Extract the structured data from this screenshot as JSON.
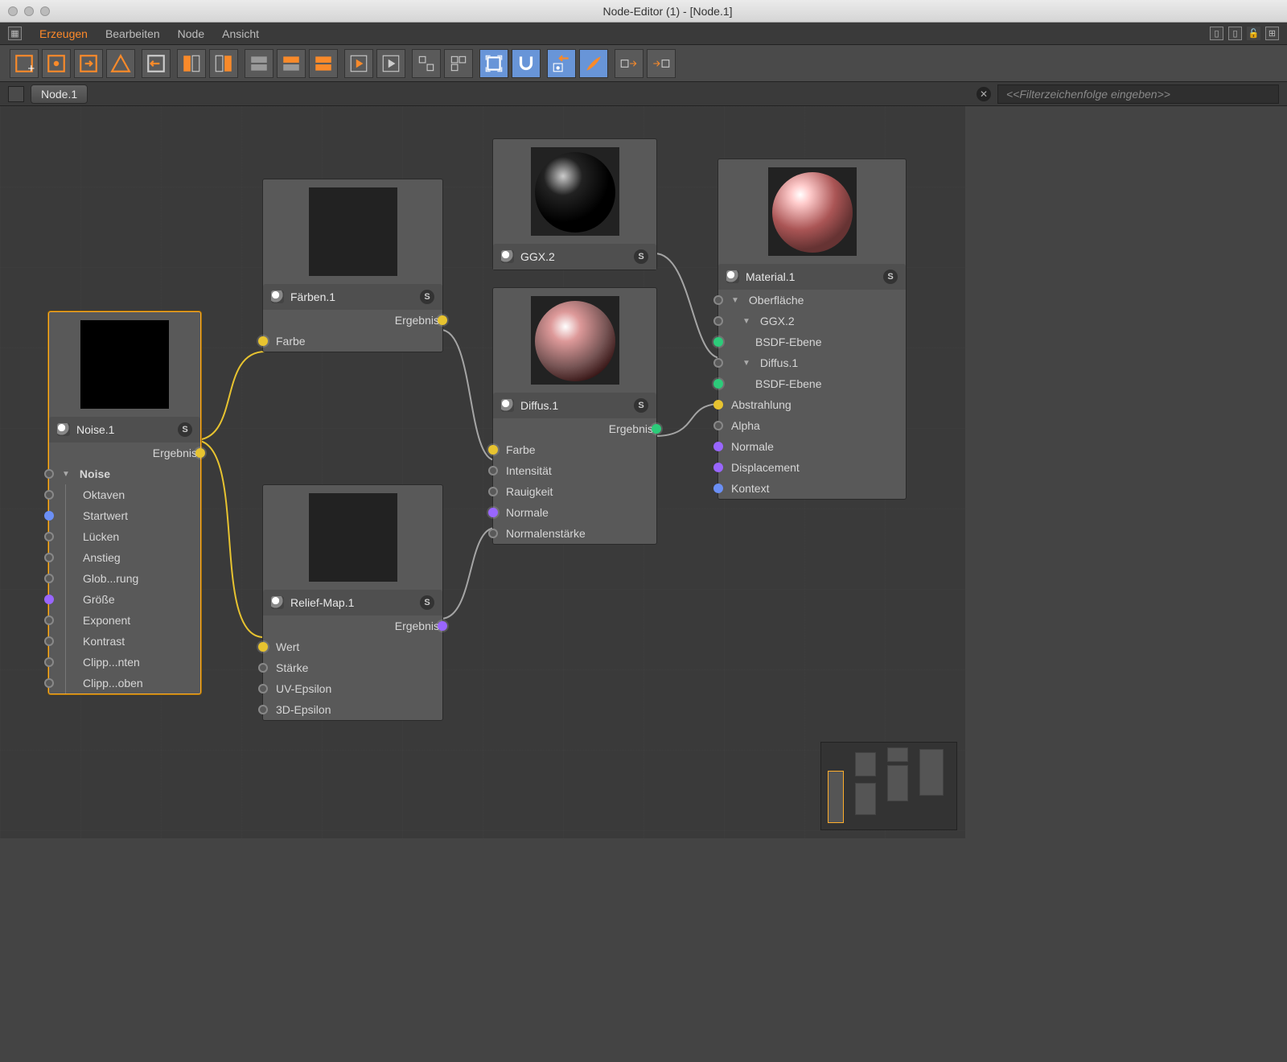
{
  "window": {
    "title": "Node-Editor (1) - [Node.1]"
  },
  "menu": {
    "erzeugen": "Erzeugen",
    "bearbeiten": "Bearbeiten",
    "node": "Node",
    "ansicht": "Ansicht"
  },
  "breadcrumb": "Node.1",
  "filter_placeholder": "<<Filterzeichenfolge eingeben>>",
  "nodes": {
    "noise": {
      "title": "Noise.1",
      "out": "Ergebnis",
      "group": "Noise",
      "params": [
        "Oktaven",
        "Startwert",
        "Lücken",
        "Anstieg",
        "Glob...rung",
        "Größe",
        "Exponent",
        "Kontrast",
        "Clipp...nten",
        "Clipp...oben"
      ]
    },
    "farben": {
      "title": "Färben.1",
      "out": "Ergebnis",
      "in": [
        "Farbe"
      ]
    },
    "relief": {
      "title": "Relief-Map.1",
      "out": "Ergebnis",
      "in": [
        "Wert",
        "Stärke",
        "UV-Epsilon",
        "3D-Epsilon"
      ]
    },
    "ggx": {
      "title": "GGX.2"
    },
    "diffus": {
      "title": "Diffus.1",
      "out": "Ergebnis",
      "in": [
        "Farbe",
        "Intensität",
        "Rauigkeit",
        "Normale",
        "Normalenstärke"
      ]
    },
    "material": {
      "title": "Material.1",
      "tree_root": "Oberfläche",
      "ggx_label": "GGX.2",
      "bsdf": "BSDF-Ebene",
      "diffus_label": "Diffus.1",
      "params": [
        "Abstrahlung",
        "Alpha",
        "Normale",
        "Displacement",
        "Kontext"
      ]
    }
  }
}
